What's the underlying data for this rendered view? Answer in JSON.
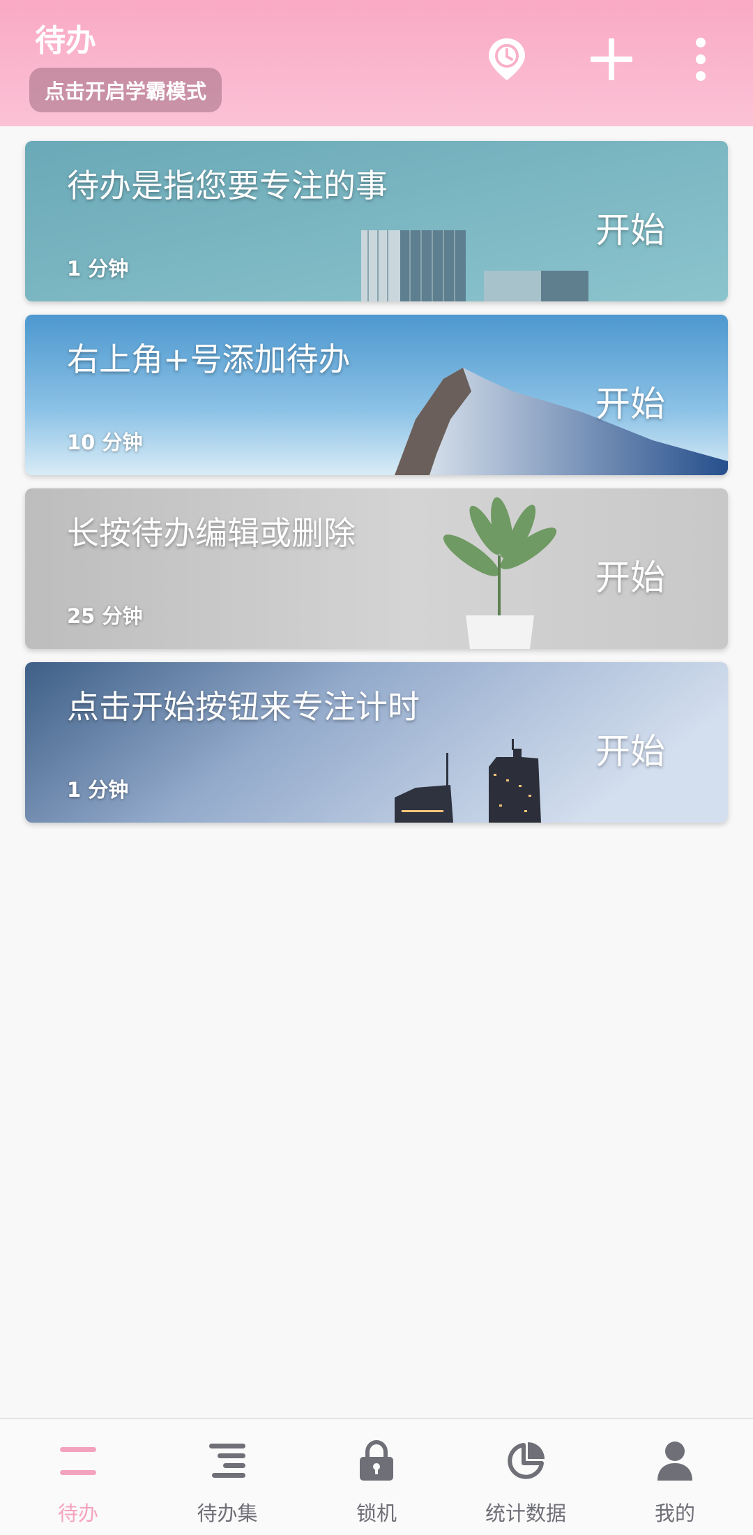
{
  "header": {
    "title": "待办",
    "study_mode_button": "点击开启学霸模式",
    "icons": [
      "clock-pin-icon",
      "plus-icon",
      "more-vertical-icon"
    ],
    "accent_color": "#f9a9c4"
  },
  "todos": [
    {
      "title": "待办是指您要专注的事",
      "duration": "1 分钟",
      "start_label": "开始",
      "background": "buildings-teal"
    },
    {
      "title": "右上角+号添加待办",
      "duration": "10 分钟",
      "start_label": "开始",
      "background": "snowy-mountain"
    },
    {
      "title": "长按待办编辑或删除",
      "duration": "25 分钟",
      "start_label": "开始",
      "background": "potted-plant"
    },
    {
      "title": "点击开始按钮来专注计时",
      "duration": "1 分钟",
      "start_label": "开始",
      "background": "city-skyline"
    }
  ],
  "bottom_nav": {
    "active_color": "#f4a3bf",
    "inactive_color": "#6f6f78",
    "items": [
      {
        "label": "待办",
        "icon": "todo-lines-icon",
        "active": true
      },
      {
        "label": "待办集",
        "icon": "todo-set-icon",
        "active": false
      },
      {
        "label": "锁机",
        "icon": "lock-icon",
        "active": false
      },
      {
        "label": "统计数据",
        "icon": "pie-chart-icon",
        "active": false
      },
      {
        "label": "我的",
        "icon": "person-icon",
        "active": false
      }
    ]
  }
}
